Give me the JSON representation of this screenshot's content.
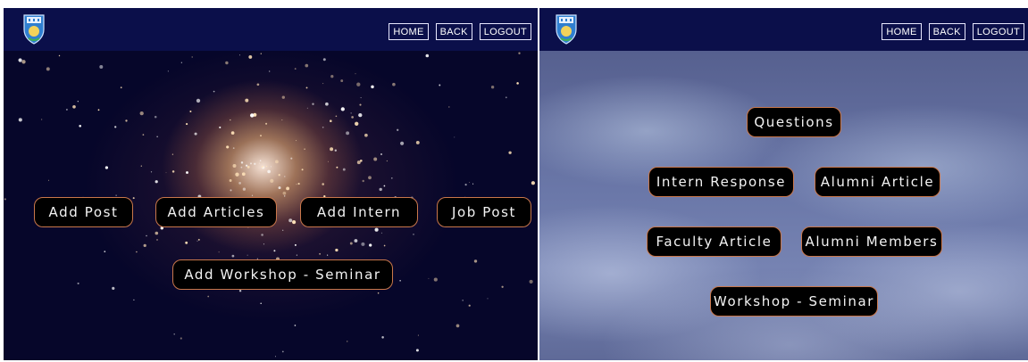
{
  "left_panel": {
    "nav": {
      "home": "HOME",
      "back": "BACK",
      "logout": "LOGOUT"
    },
    "buttons": {
      "add_post": "Add Post",
      "add_articles": "Add Articles",
      "add_intern": "Add Intern",
      "job_post": "Job Post",
      "add_workshop": "Add Workshop - Seminar"
    }
  },
  "right_panel": {
    "nav": {
      "home": "HOME",
      "back": "BACK",
      "logout": "LOGOUT"
    },
    "buttons": {
      "questions": "Questions",
      "intern_response": "Intern Response",
      "alumni_article": "Alumni Article",
      "faculty_article": "Faculty Article",
      "alumni_members": "Alumni Members",
      "workshop_seminar": "Workshop - Seminar"
    }
  },
  "icons": {
    "logo": "university-crest-icon"
  },
  "colors": {
    "navbar": "#0b0f4a",
    "button_bg": "#000000",
    "button_border": "#c9774b",
    "button_text": "#f3f3f3"
  }
}
